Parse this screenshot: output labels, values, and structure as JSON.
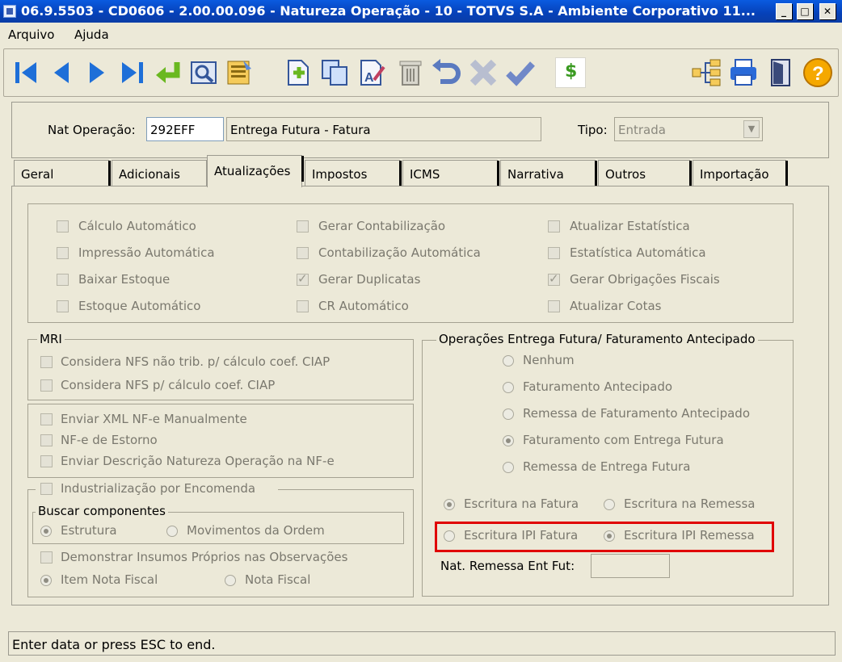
{
  "window": {
    "title": "06.9.5503 - CD0606 - 2.00.00.096 - Natureza Operação - 10 - TOTVS S.A - Ambiente Corporativo 11..."
  },
  "menu": {
    "items": [
      "Arquivo",
      "Ajuda"
    ]
  },
  "header": {
    "nat_label": "Nat Operação:",
    "nat_code": "292EFF",
    "nat_desc": "Entrega Futura - Fatura",
    "tipo_label": "Tipo:",
    "tipo_value": "Entrada"
  },
  "tabs": [
    "Geral",
    "Adicionais",
    "Atualizações",
    "Impostos",
    "ICMS",
    "Narrativa",
    "Outros",
    "Importação"
  ],
  "active_tab": "Atualizações",
  "atualizacoes": {
    "col1": [
      {
        "label": "Cálculo Automático",
        "checked": false
      },
      {
        "label": "Impressão Automática",
        "checked": false
      },
      {
        "label": "Baixar Estoque",
        "checked": false
      },
      {
        "label": "Estoque Automático",
        "checked": false
      }
    ],
    "col2": [
      {
        "label": "Gerar Contabilização",
        "checked": false
      },
      {
        "label": "Contabilização Automática",
        "checked": false
      },
      {
        "label": "Gerar Duplicatas",
        "checked": true
      },
      {
        "label": "CR Automático",
        "checked": false
      }
    ],
    "col3": [
      {
        "label": "Atualizar Estatística",
        "checked": false
      },
      {
        "label": "Estatística Automática",
        "checked": false
      },
      {
        "label": "Gerar Obrigações Fiscais",
        "checked": true
      },
      {
        "label": "Atualizar Cotas",
        "checked": false
      }
    ]
  },
  "mri": {
    "title": "MRI",
    "items": [
      "Considera NFS não trib. p/ cálculo coef. CIAP",
      "Considera NFS p/ cálculo coef. CIAP"
    ]
  },
  "nfe": {
    "items": [
      "Enviar XML NF-e Manualmente",
      "NF-e de Estorno",
      "Enviar Descrição Natureza Operação na NF-e"
    ]
  },
  "industrializacao": {
    "title": "Industrialização por Encomenda",
    "buscar_title": "Buscar componentes",
    "buscar_opt1": "Estrutura",
    "buscar_opt2": "Movimentos da Ordem",
    "demonstrar": "Demonstrar Insumos Próprios nas Observações",
    "nota_opt1": "Item Nota Fiscal",
    "nota_opt2": "Nota Fiscal"
  },
  "operacoes": {
    "title": "Operações Entrega Futura/ Faturamento Antecipado",
    "options": [
      {
        "label": "Nenhum",
        "selected": false
      },
      {
        "label": "Faturamento Antecipado",
        "selected": false
      },
      {
        "label": "Remessa de Faturamento Antecipado",
        "selected": false
      },
      {
        "label": "Faturamento com Entrega Futura",
        "selected": true
      },
      {
        "label": "Remessa de Entrega Futura",
        "selected": false
      }
    ],
    "escritura_fatura": "Escritura na Fatura",
    "escritura_remessa": "Escritura na Remessa",
    "ipi_fatura": "Escritura IPI Fatura",
    "ipi_remessa": "Escritura IPI Remessa",
    "nat_remessa_label": "Nat. Remessa Ent Fut:",
    "nat_remessa_value": ""
  },
  "status": {
    "text": "Enter data or press ESC to end."
  },
  "colors": {
    "title_bar": "#0641b8",
    "highlight_box": "#e00000",
    "tb_blue": "#1e6fd8",
    "tb_green": "#6ab820"
  }
}
